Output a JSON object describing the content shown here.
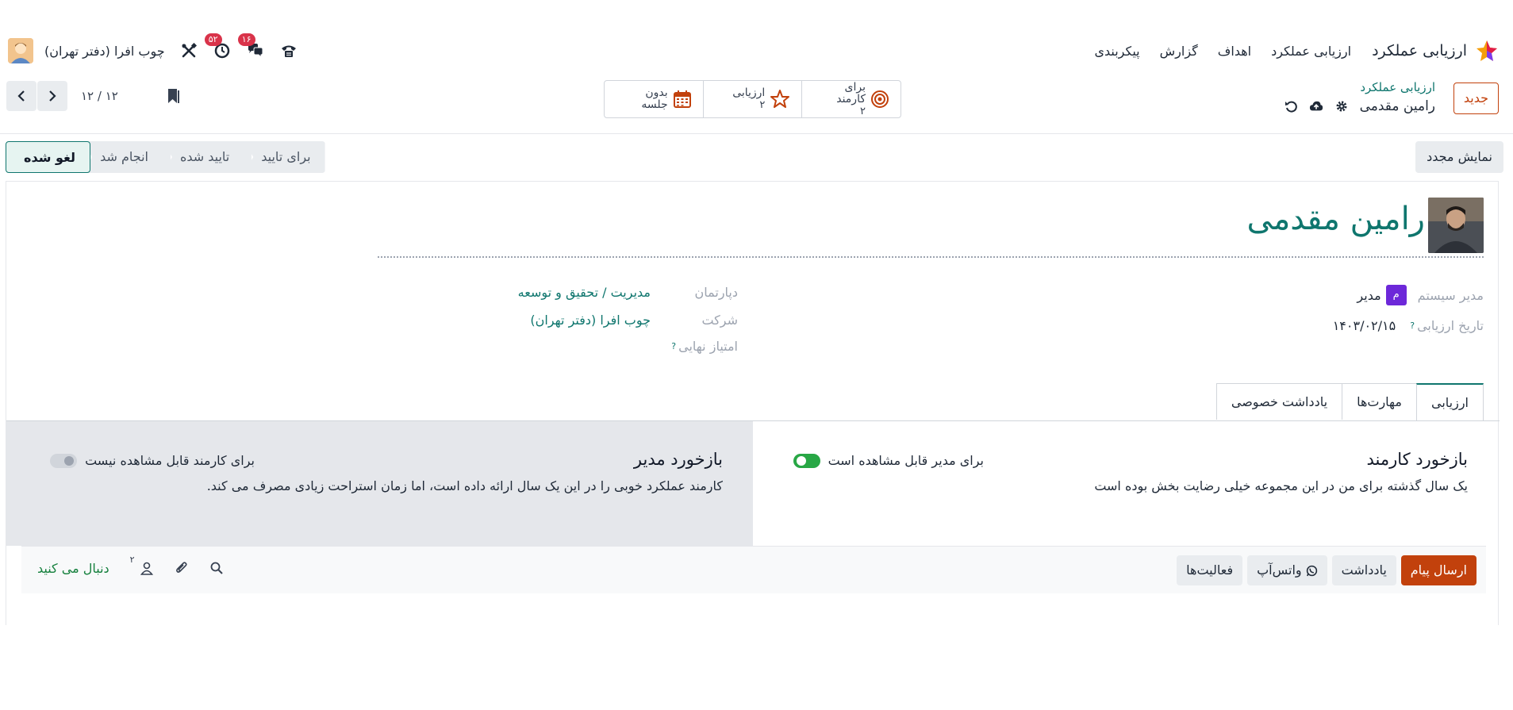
{
  "navbar": {
    "app_name": "ارزیابی عملکرد",
    "menu": [
      "ارزیابی عملکرد",
      "اهداف",
      "گزارش",
      "پیکربندی"
    ],
    "company": "چوب افرا (دفتر تهران)",
    "activity_badge": "۵۲",
    "messages_badge": "۱۶"
  },
  "control": {
    "new_label": "جدید",
    "breadcrumb_parent": "ارزیابی عملکرد",
    "breadcrumb_current": "رامین مقدمی",
    "stats": [
      {
        "label": "برای کارمند",
        "value": "۲",
        "icon": "target-icon"
      },
      {
        "label": "ارزیابی",
        "value": "۲",
        "icon": "star-icon"
      },
      {
        "label": "بدون جلسه",
        "value": "",
        "icon": "calendar-icon"
      }
    ],
    "pager": "۱۲ / ۱۲"
  },
  "statusbar": {
    "redisplay_label": "نمایش مجدد",
    "stages": [
      "برای تایید",
      "تایید شده",
      "انجام شد",
      "لغو شده"
    ],
    "active_stage": "لغو شده"
  },
  "form": {
    "employee_name": "رامین مقدمی",
    "manager_label": "مدیر",
    "manager_initial": "م",
    "manager_name": "مدیر سیستم",
    "date_label": "تاریخ ارزیابی",
    "date_value": "۱۴۰۳/۰۲/۱۵",
    "department_label": "دپارتمان",
    "department_value": "مدیریت / تحقیق و توسعه",
    "company_label": "شرکت",
    "company_value": "چوب افرا (دفتر تهران)",
    "final_score_label": "امتیاز نهایی"
  },
  "tabs": [
    "ارزیابی",
    "مهارت‌ها",
    "یادداشت خصوصی"
  ],
  "feedback": {
    "employee_title": "بازخورد کارمند",
    "employee_text": "یک سال گذشته برای من در این مجموعه خیلی رضایت بخش بوده است",
    "employee_toggle_label": "برای مدیر قابل مشاهده است",
    "manager_title": "بازخورد مدیر",
    "manager_text": "کارمند عملکرد خوبی را در این یک سال ارائه داده است، اما زمان استراحت زیادی مصرف می کند.",
    "manager_toggle_label": "برای کارمند قابل مشاهده نیست"
  },
  "chatter": {
    "send_message": "ارسال پیام",
    "log_note": "یادداشت",
    "whatsapp": "واتس‌آپ",
    "activities": "فعالیت‌ها",
    "followers_count": "۲",
    "follow_label": "دنبال می کنید"
  },
  "colors": {
    "brand_orange": "#c2410c",
    "teal": "#0f766e",
    "green": "#28a745",
    "badge_red": "#d9334a",
    "manager_chip": "#6d28d9"
  }
}
